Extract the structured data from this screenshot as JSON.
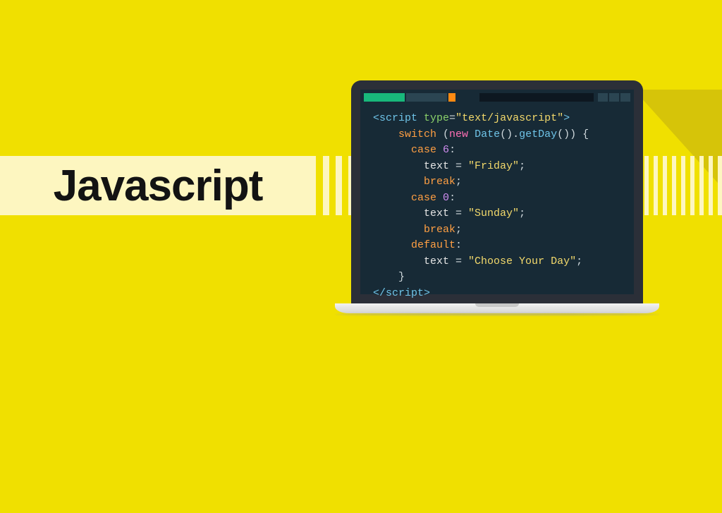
{
  "title": "Javascript",
  "code": {
    "open_tag": "<script",
    "attr_name": "type",
    "attr_value": "\"text/javascript\"",
    "close_angle": ">",
    "kw_switch": "switch",
    "kw_new": "new",
    "fn_date": "Date",
    "fn_getday": "getDay",
    "brace_open": "{",
    "kw_case1": "case",
    "num_case1": "6",
    "var_text": "text",
    "eq": " = ",
    "str_friday": "\"Friday\"",
    "semi": ";",
    "kw_break": "break",
    "kw_case2": "case",
    "num_case2": "0",
    "str_sunday": "\"Sunday\"",
    "kw_default": "default",
    "str_choose": "\"Choose Your Day\"",
    "brace_close": "}",
    "close_tag": "script"
  }
}
